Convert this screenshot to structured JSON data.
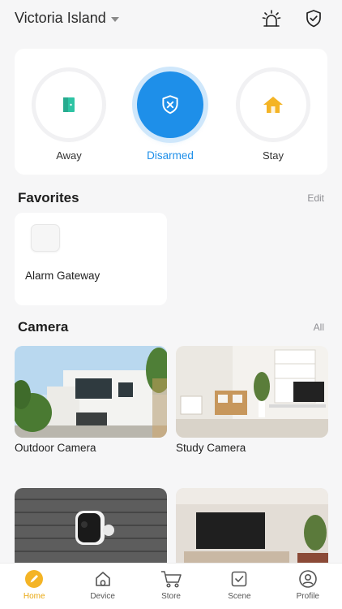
{
  "header": {
    "location": "Victoria Island",
    "icons": [
      "alarm-siren-icon",
      "shield-check-icon"
    ]
  },
  "modes": [
    {
      "label": "Away",
      "icon": "away-door-icon",
      "color": "#2ec4a4"
    },
    {
      "label": "Disarmed",
      "icon": "shield-x-icon",
      "color": "#1e8fe9",
      "active": true
    },
    {
      "label": "Stay",
      "icon": "house-icon",
      "color": "#f4b425"
    }
  ],
  "favorites": {
    "title": "Favorites",
    "edit_label": "Edit",
    "items": [
      {
        "label": "Alarm Gateway",
        "icon": "gateway-device-icon"
      }
    ]
  },
  "camera": {
    "title": "Camera",
    "all_label": "All",
    "items": [
      {
        "label": "Outdoor Camera"
      },
      {
        "label": "Study Camera"
      },
      {
        "label": ""
      },
      {
        "label": ""
      }
    ]
  },
  "nav": {
    "items": [
      {
        "label": "Home",
        "icon": "home-icon",
        "active": true
      },
      {
        "label": "Device",
        "icon": "device-icon"
      },
      {
        "label": "Store",
        "icon": "cart-icon"
      },
      {
        "label": "Scene",
        "icon": "scene-check-icon"
      },
      {
        "label": "Profile",
        "icon": "profile-icon"
      }
    ]
  },
  "colors": {
    "accent": "#1e8fe9",
    "nav_active": "#e8a70f",
    "away": "#2ec4a4",
    "stay": "#f4b425"
  }
}
